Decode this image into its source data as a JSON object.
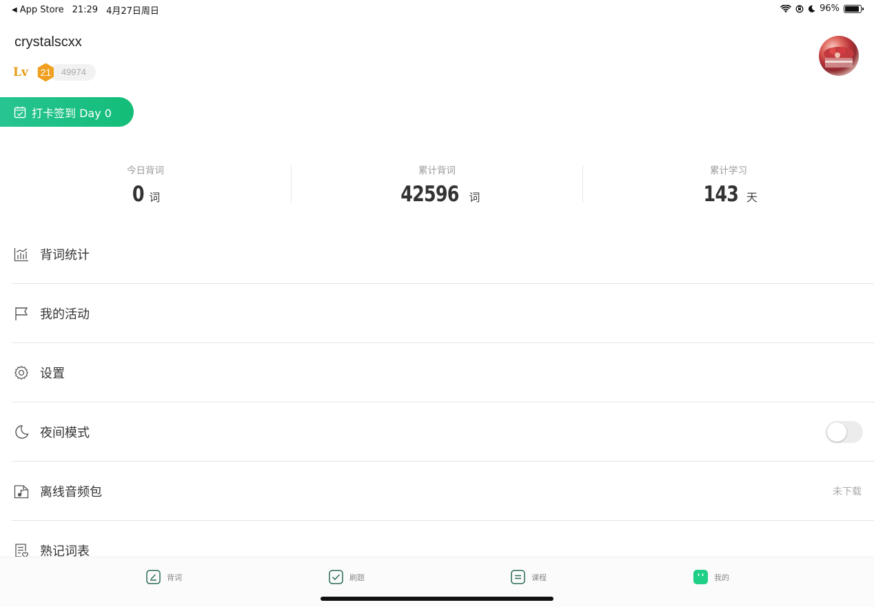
{
  "status_bar": {
    "back_label": "App Store",
    "time": "21:29",
    "date": "4月27日周日",
    "battery": "96%",
    "battery_level": 0.96
  },
  "profile": {
    "username": "crystalscxx",
    "lv_label": "Lv",
    "level": "21",
    "points": "49974"
  },
  "checkin": {
    "label": "打卡签到 Day 0"
  },
  "stats": [
    {
      "label": "今日背词",
      "value": "0",
      "unit": "词"
    },
    {
      "label": "累计背词",
      "value": "42596",
      "unit": "词"
    },
    {
      "label": "累计学习",
      "value": "143",
      "unit": "天"
    }
  ],
  "menu": [
    {
      "label": "背词统计",
      "icon": "chart-icon"
    },
    {
      "label": "我的活动",
      "icon": "flag-icon"
    },
    {
      "label": "设置",
      "icon": "gear-icon"
    },
    {
      "label": "夜间模式",
      "icon": "moon-icon",
      "toggle_on": false
    },
    {
      "label": "离线音频包",
      "icon": "music-file-icon",
      "right_text": "未下载"
    },
    {
      "label": "熟记词表",
      "icon": "list-heart-icon"
    }
  ],
  "tabs": [
    {
      "label": "背词",
      "icon": "pencil-icon"
    },
    {
      "label": "刷题",
      "icon": "check-icon"
    },
    {
      "label": "课程",
      "icon": "lines-icon"
    },
    {
      "label": "我的",
      "icon": "face-icon",
      "active": true
    }
  ],
  "colors": {
    "accent": "#18be7e",
    "level_gold": "#f0a020",
    "text": "#333333",
    "muted": "#999999"
  }
}
